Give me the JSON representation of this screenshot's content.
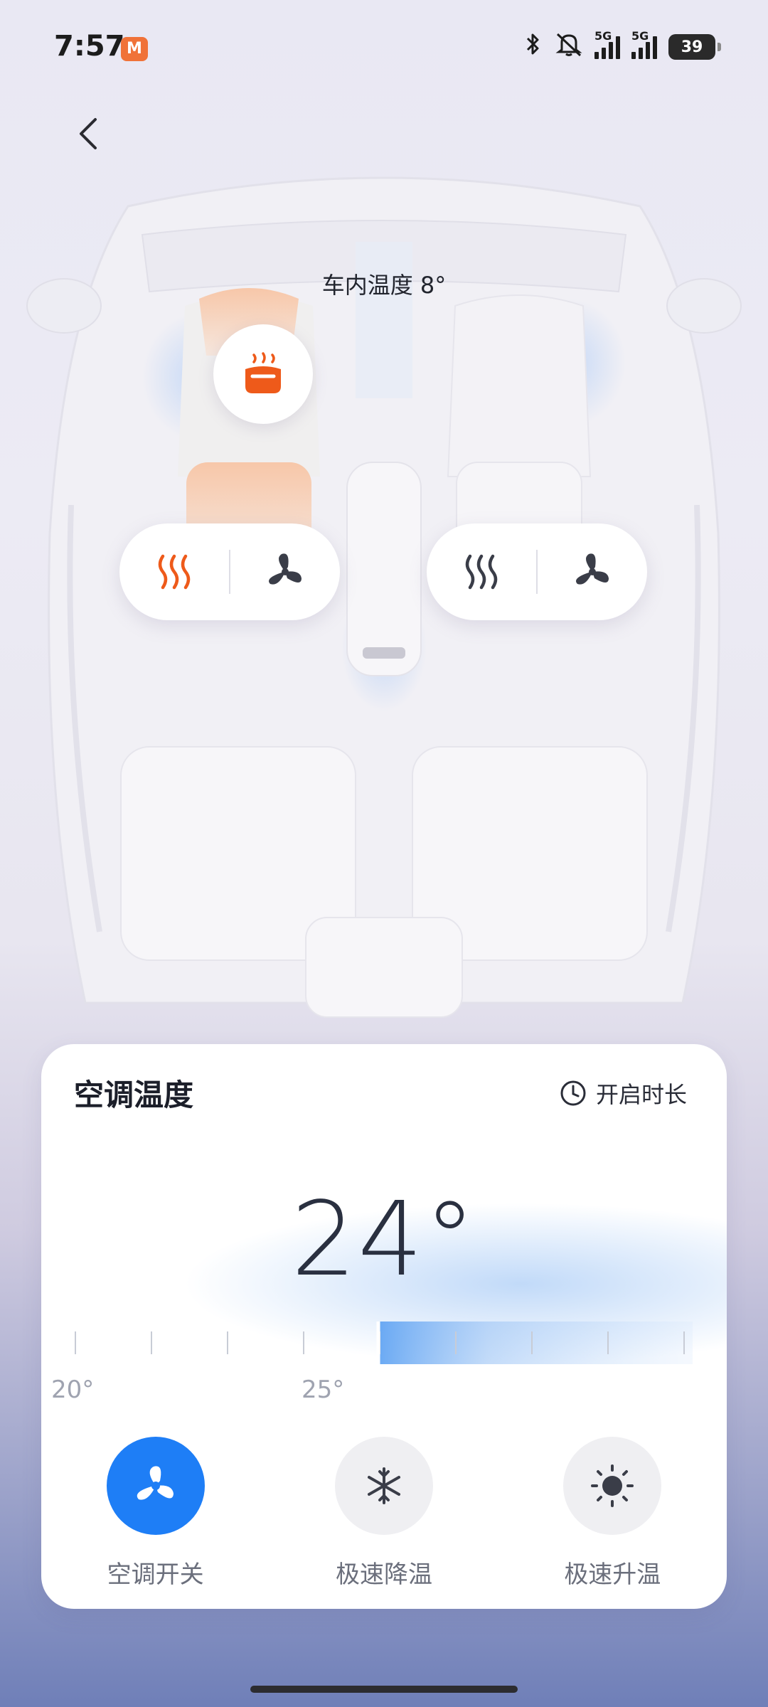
{
  "status_bar": {
    "time": "7:57",
    "app_badge_text": "M",
    "signal1_label": "5G",
    "signal2_label": "5G",
    "battery_level": "39"
  },
  "header": {
    "cabin_temperature": "车内温度 8°"
  },
  "seats": {
    "driver": {
      "heat_active": true,
      "fan_active": false
    },
    "passenger": {
      "heat_active": false,
      "fan_active": false
    },
    "headrest_heat_active": true
  },
  "ac_card": {
    "title": "空调温度",
    "timer_label": "开启时长",
    "current_temp": "24°",
    "ruler": {
      "min": 20,
      "max": 28,
      "value": 24
    },
    "tick_label_low": "20°",
    "tick_label_mid": "25°",
    "actions": [
      {
        "label": "空调开关",
        "icon": "fan-icon",
        "active": true
      },
      {
        "label": "极速降温",
        "icon": "snowflake-icon",
        "active": false
      },
      {
        "label": "极速升温",
        "icon": "sun-icon",
        "active": false
      }
    ]
  },
  "colors": {
    "accent_orange": "#ee5a1a",
    "accent_blue": "#1e7ef6"
  }
}
